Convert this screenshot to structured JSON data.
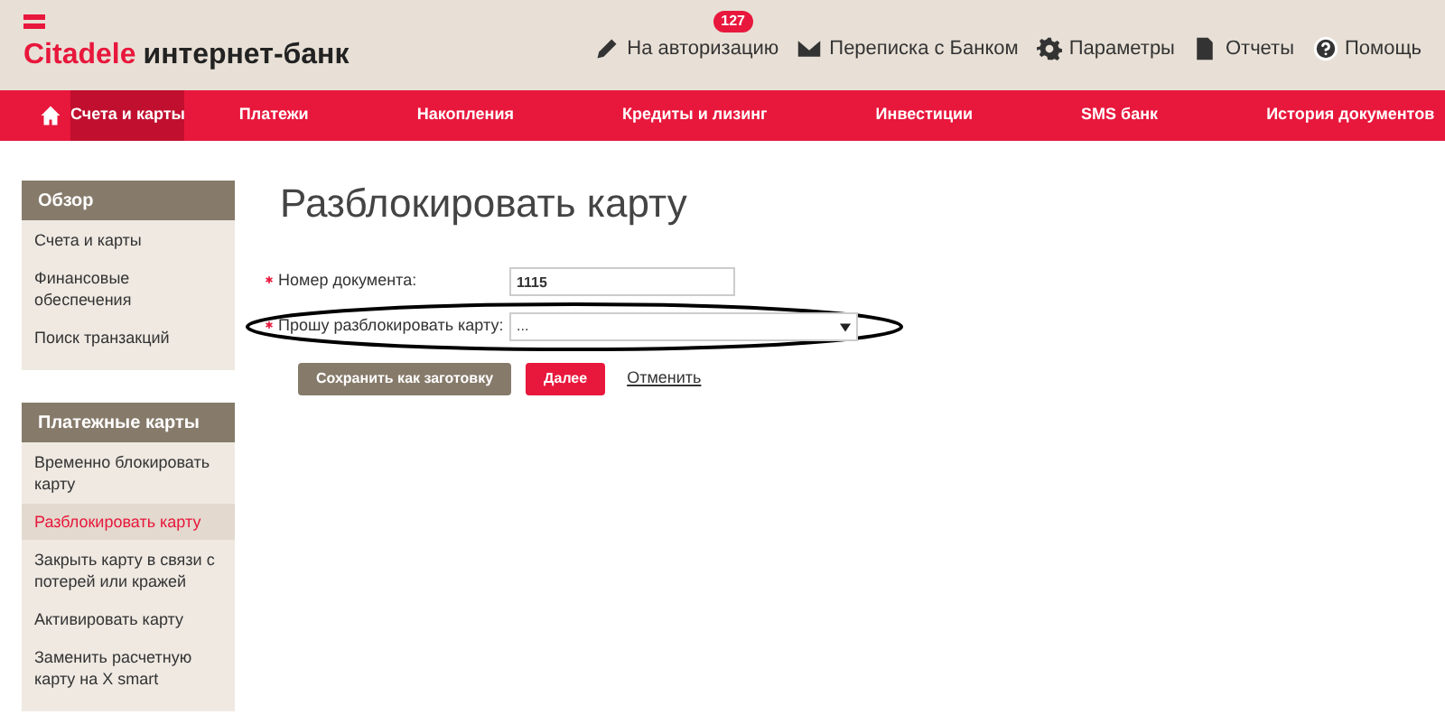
{
  "logo": {
    "brand": "Citadele",
    "product": "интернет-банк"
  },
  "top_links": [
    {
      "kind": "pencil",
      "label": "На авторизацию",
      "badge": "127"
    },
    {
      "kind": "mail",
      "label": "Переписка с Банком"
    },
    {
      "kind": "gear",
      "label": "Параметры"
    },
    {
      "kind": "doc",
      "label": "Отчеты"
    },
    {
      "kind": "help",
      "label": "Помощь"
    }
  ],
  "nav": [
    {
      "label": "Счета и карты",
      "selected": true
    },
    {
      "label": "Платежи",
      "selected": false
    },
    {
      "label": "Накопления",
      "selected": false
    },
    {
      "label": "Кредиты и лизинг",
      "selected": false
    },
    {
      "label": "Инвестиции",
      "selected": false
    },
    {
      "label": "SMS банк",
      "selected": false
    },
    {
      "label": "История документов",
      "selected": false
    }
  ],
  "sidebar": [
    {
      "title": "Обзор",
      "items": [
        {
          "label": "Счета и карты",
          "selected": false
        },
        {
          "label": "Финансовые обеспечения",
          "selected": false
        },
        {
          "label": "Поиск транзакций",
          "selected": false
        }
      ]
    },
    {
      "title": "Платежные карты",
      "items": [
        {
          "label": "Временно блокировать карту",
          "selected": false
        },
        {
          "label": "Разблокировать карту",
          "selected": true
        },
        {
          "label": "Закрыть карту в связи с потерей или кражей",
          "selected": false
        },
        {
          "label": "Активировать карту",
          "selected": false
        },
        {
          "label": "Заменить расчетную карту на X smart",
          "selected": false
        }
      ]
    }
  ],
  "page_title": "Разблокировать карту",
  "form": [
    {
      "kind": "text",
      "label": "Номер документа:",
      "value": "1115",
      "required": true,
      "highlighted": false
    },
    {
      "kind": "select",
      "label": "Прошу разблокировать карту:",
      "value": "...",
      "required": true,
      "highlighted": true
    }
  ],
  "buttons": [
    {
      "kind": "secondary",
      "label": "Сохранить как заготовку"
    },
    {
      "kind": "primary",
      "label": "Далее"
    },
    {
      "kind": "link",
      "label": "Отменить"
    }
  ]
}
